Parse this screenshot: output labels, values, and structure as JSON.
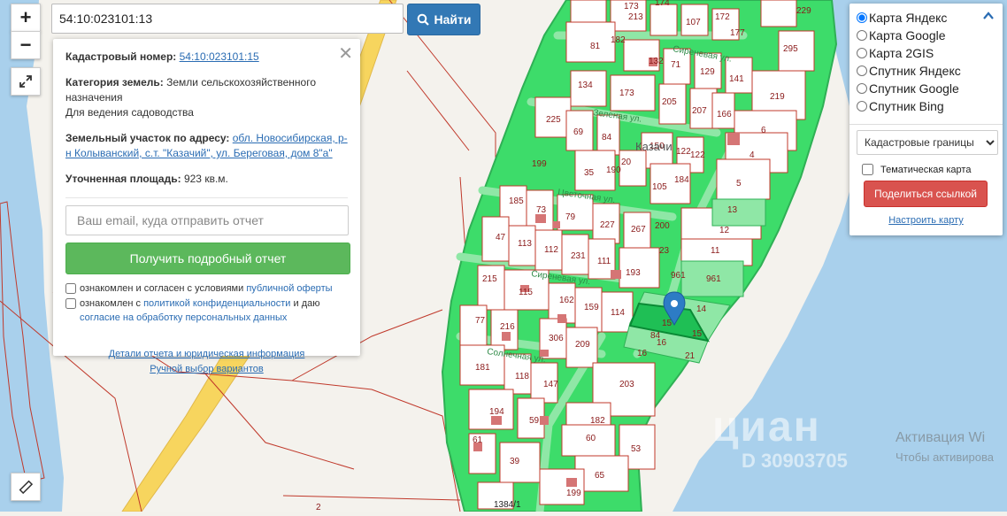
{
  "map": {
    "parcels": [
      "173",
      "213",
      "174",
      "107",
      "172",
      "177",
      "229",
      "81",
      "182",
      "132",
      "71",
      "129",
      "141",
      "295",
      "134",
      "173",
      "205",
      "207",
      "166",
      "219",
      "225",
      "69",
      "84",
      "150",
      "122",
      "122",
      "6",
      "4",
      "199",
      "35",
      "190",
      "20",
      "105",
      "184",
      "5",
      "185",
      "73",
      "79",
      "227",
      "267",
      "13",
      "12",
      "11",
      "47",
      "113",
      "112",
      "231",
      "111",
      "193",
      "200",
      "23",
      "961",
      "961",
      "215",
      "115",
      "162",
      "159",
      "114",
      "14",
      "15",
      "15",
      "77",
      "216",
      "306",
      "209",
      "84",
      "16",
      "16",
      "21",
      "181",
      "118",
      "147",
      "203",
      "194",
      "59",
      "182",
      "61",
      "60",
      "53",
      "39",
      "65",
      "199",
      "1384/1",
      "2"
    ],
    "streets": [
      "Сиреневая ул.",
      "Зеленая ул.",
      "Цветочная ул.",
      "Сиреневая ул.",
      "Солнечная ул."
    ],
    "village_label": "Казачи"
  },
  "zoom": {
    "in_label": "+",
    "out_label": "−"
  },
  "icons": {
    "fullscreen": "expand-icon",
    "ruler": "ruler-icon",
    "search": "search-icon",
    "close": "close-icon",
    "chevron": "chevron-up-icon",
    "marker": "map-marker-icon"
  },
  "search": {
    "value": "54:10:023101:13",
    "button_label": "Найти"
  },
  "info": {
    "cad_label": "Кадастровый номер:",
    "cad_value": "54:10:023101:15",
    "category_label": "Категория земель:",
    "category_value": "Земли сельскохозяйственного назначения",
    "usage": "Для ведения садоводства",
    "address_label": "Земельный участок по адресу:",
    "address_value": "обл. Новосибирская, р-н Колыванский, с.т. \"Казачий\", ул. Береговая, дом 8\"а\"",
    "area_label": "Уточненная площадь:",
    "area_value": "923",
    "area_unit": "кв.м.",
    "email_placeholder": "Ваш email, куда отправить отчет",
    "report_button": "Получить подробный отчет",
    "consent1_text": "ознакомлен и согласен с условиями",
    "consent1_link": "публичной оферты",
    "consent2_text": "ознакомлен с",
    "consent2_link1": "политикой конфиденциальности",
    "consent2_mid": "и даю",
    "consent2_link2": "согласие на обработку персональных данных",
    "details_link": "Детали отчета и юридическая информация",
    "manual_link": "Ручной выбор вариантов"
  },
  "layers": {
    "options": [
      "Карта Яндекс",
      "Карта Google",
      "Карта 2GIS",
      "Спутник Яндекс",
      "Спутник Google",
      "Спутник Bing"
    ],
    "selected_index": 0,
    "select_value": "Кадастровые границы",
    "thematic_label": "Тематическая карта",
    "share_button": "Поделиться ссылкой",
    "setup_link": "Настроить карту"
  },
  "watermark": {
    "title": "Активация Wi",
    "subtitle": "Чтобы активирова",
    "brand": "циан",
    "listing_id": "D 30903705"
  },
  "colors": {
    "parcel_green": "#3ddc6a",
    "parcel_border": "#c0392b",
    "water": "#a9d0ec",
    "road": "#f7d55e",
    "selected": "#1fbf55"
  }
}
